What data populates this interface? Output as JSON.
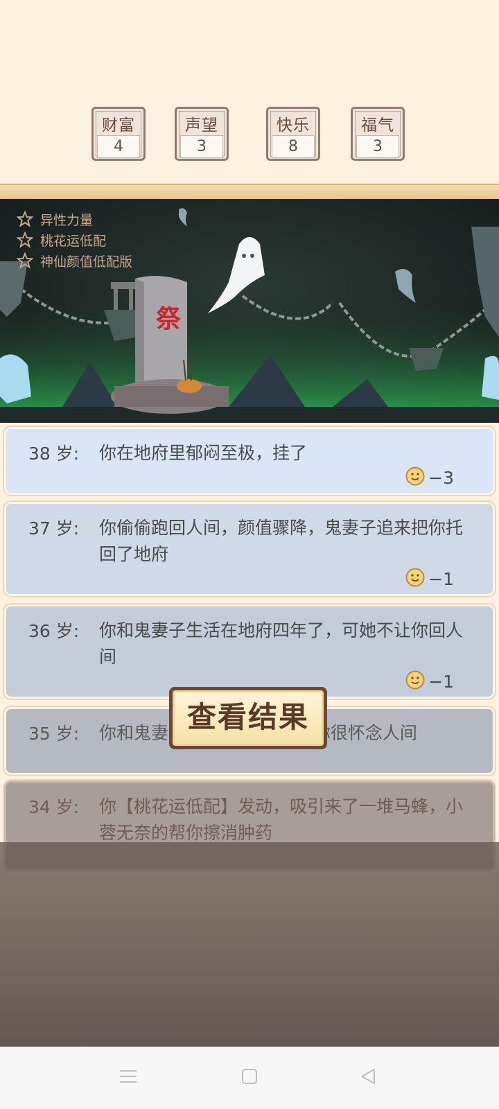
{
  "stats": [
    {
      "label": "财富",
      "value": "4"
    },
    {
      "label": "声望",
      "value": "3"
    },
    {
      "label": "快乐",
      "value": "8"
    },
    {
      "label": "福气",
      "value": "3"
    }
  ],
  "traits": [
    "异性力量",
    "桃花运低配",
    "神仙颜值低配版"
  ],
  "tombstone_char": "祭",
  "log": [
    {
      "age": "38 岁:",
      "text": "你在地府里郁闷至极，挂了",
      "delta": "−3",
      "icon": "smiley-face-icon"
    },
    {
      "age": "37 岁:",
      "text": "你偷偷跑回人间，颜值骤降，鬼妻子追来把你托回了地府",
      "delta": "−1",
      "icon": "smiley-face-icon"
    },
    {
      "age": "36 岁:",
      "text": "你和鬼妻子生活在地府四年了，可她不让你回人间",
      "delta": "−1",
      "icon": "smiley-face-icon"
    },
    {
      "age": "35 岁:",
      "text": "你和鬼妻                    了，你很怀念人间",
      "delta": "",
      "icon": ""
    },
    {
      "age": "34 岁:",
      "text": "你【桃花运低配】发动，吸引来了一堆马蜂，小蓉无奈的帮你擦消肿药",
      "delta": "",
      "icon": ""
    }
  ],
  "result_button": "查看结果",
  "navbar": {
    "menu": "menu-icon",
    "home": "home-square-icon",
    "back": "back-triangle-icon"
  }
}
